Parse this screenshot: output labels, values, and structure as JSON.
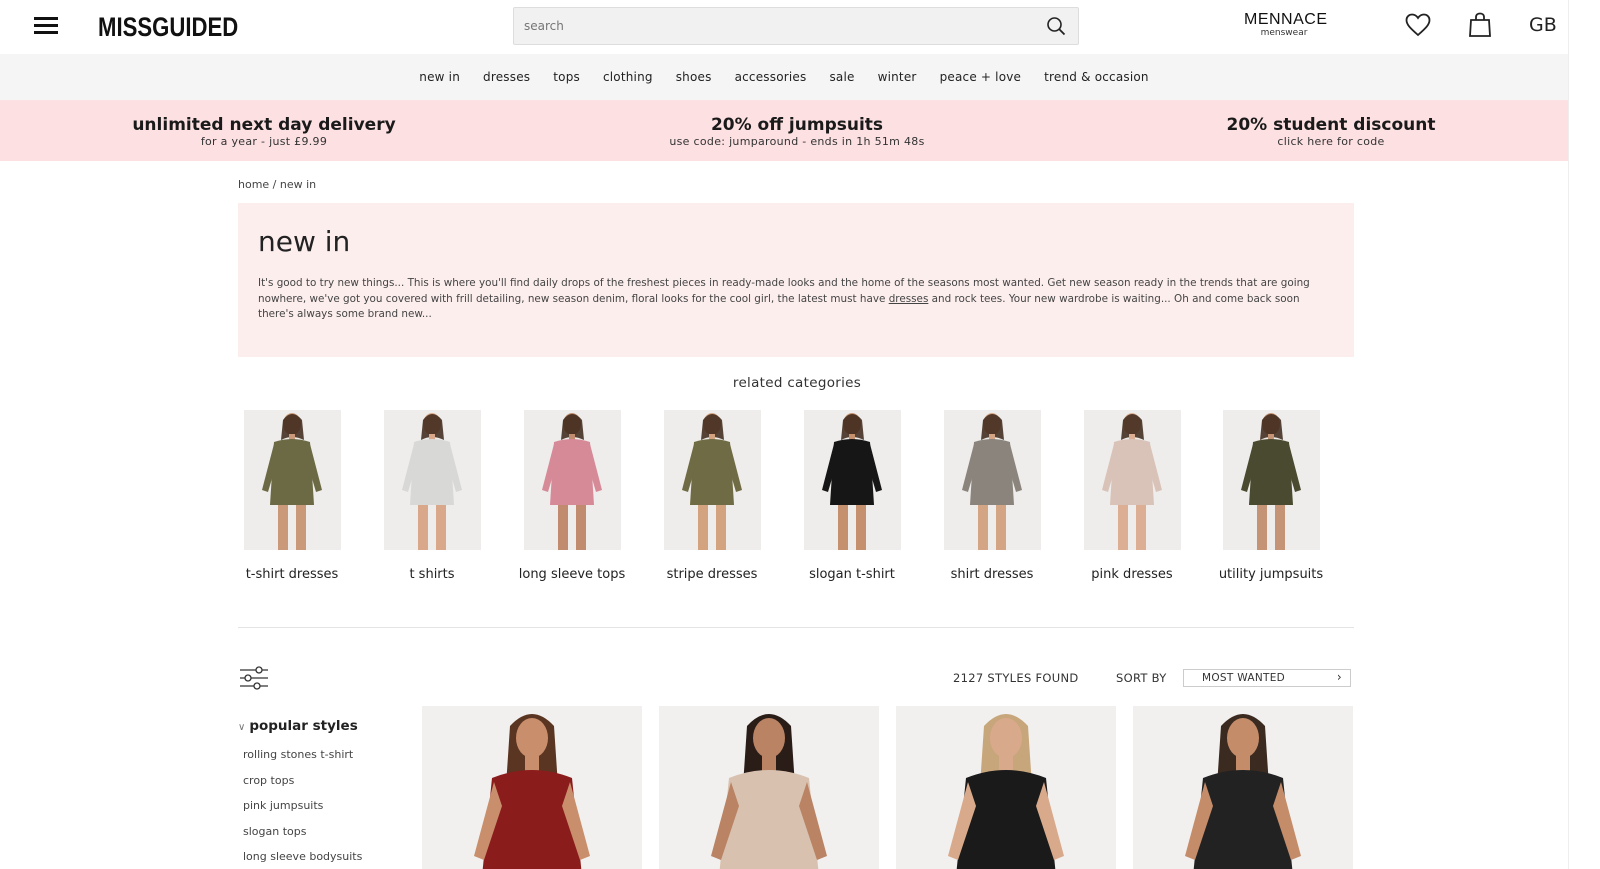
{
  "header": {
    "logo": "MISSGUIDED",
    "search_placeholder": "search",
    "mennace_title": "MENNACE",
    "mennace_sub": "menswear",
    "region": "GB"
  },
  "nav": [
    "new in",
    "dresses",
    "tops",
    "clothing",
    "shoes",
    "accessories",
    "sale",
    "winter",
    "peace + love",
    "trend & occasion"
  ],
  "promos": [
    {
      "title": "unlimited next day delivery",
      "sub": "for a year - just £9.99"
    },
    {
      "title": "20% off jumpsuits",
      "sub": "use code: jumparound - ends in 1h 51m 48s"
    },
    {
      "title": "20% student discount",
      "sub": "click here for code"
    }
  ],
  "breadcrumb": {
    "home": "home",
    "sep": " / ",
    "current": "new in"
  },
  "intro": {
    "title": "new in",
    "text_before": "It's good to try new things... This is where you'll find daily drops of the freshest pieces in ready-made looks and the home of the seasons most wanted. Get new season ready in the trends that are going nowhere, we've got you covered with frill detailing, new season denim, floral looks for the cool girl, the latest must have ",
    "link": "dresses",
    "text_after": " and rock tees. Your new wardrobe is waiting... Oh and come back soon there's always some brand new..."
  },
  "related_title": "related categories",
  "categories": [
    {
      "label": "t-shirt dresses",
      "color": "#6b6a45",
      "skin": "#c9997a"
    },
    {
      "label": "t shirts",
      "color": "#d8d8d6",
      "skin": "#d9a88a"
    },
    {
      "label": "long sleeve tops",
      "color": "#d68a98",
      "skin": "#c08b6e"
    },
    {
      "label": "stripe dresses",
      "color": "#6f6b44",
      "skin": "#d3a27e"
    },
    {
      "label": "slogan t-shirt",
      "color": "#161616",
      "skin": "#c4906e"
    },
    {
      "label": "shirt dresses",
      "color": "#8a847c",
      "skin": "#d4a584"
    },
    {
      "label": "pink dresses",
      "color": "#d9c2b7",
      "skin": "#dcaf94"
    },
    {
      "label": "utility jumpsuits",
      "color": "#4a4a30",
      "skin": "#c59375"
    }
  ],
  "listing": {
    "styles_found": "2127 STYLES FOUND",
    "sort_label": "SORT BY",
    "sort_value": "MOST WANTED"
  },
  "popular": {
    "title": "popular styles",
    "items": [
      "rolling stones t-shirt",
      "crop tops",
      "pink jumpsuits",
      "slogan tops",
      "long sleeve bodysuits"
    ]
  },
  "products": [
    {
      "color": "#8b1c1c",
      "skin": "#c98e6c",
      "hair": "#5a3522"
    },
    {
      "color": "#d9c1b0",
      "skin": "#b98364",
      "hair": "#2a1d18"
    },
    {
      "color": "#1a1a1a",
      "skin": "#d9a98b",
      "hair": "#c8a67c"
    },
    {
      "color": "#222222",
      "skin": "#c58c6a",
      "hair": "#3b2a20"
    }
  ]
}
